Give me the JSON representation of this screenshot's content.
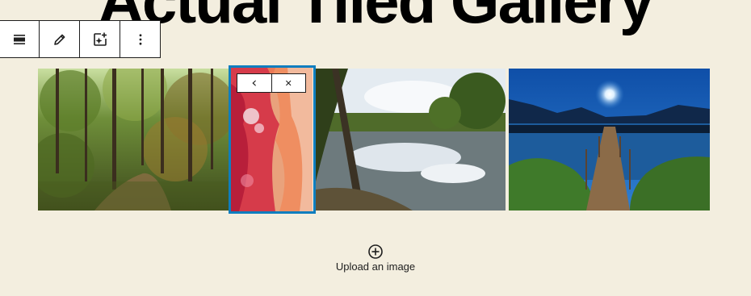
{
  "page": {
    "title": "Actual Tiled Gallery"
  },
  "block_toolbar": {
    "buttons": [
      {
        "icon": "align-icon"
      },
      {
        "icon": "pencil-icon"
      },
      {
        "icon": "add-image-icon"
      },
      {
        "icon": "more-vertical-icon"
      }
    ]
  },
  "gallery": {
    "images": [
      {
        "name": "forest-path-image",
        "selected": false
      },
      {
        "name": "red-aerial-image",
        "selected": true
      },
      {
        "name": "lake-reflection-image",
        "selected": false
      },
      {
        "name": "night-pier-image",
        "selected": false
      }
    ],
    "image_toolbar": {
      "move_left_icon": "chevron-left-icon",
      "remove_icon": "close-icon",
      "move_left_glyph": "‹",
      "remove_glyph": "✕"
    }
  },
  "upload": {
    "label": "Upload an image",
    "icon": "plus-circle-icon"
  },
  "colors": {
    "background": "#f3eedf",
    "selection": "#0f7ebf",
    "toolbar_border": "#1e1e1e"
  }
}
